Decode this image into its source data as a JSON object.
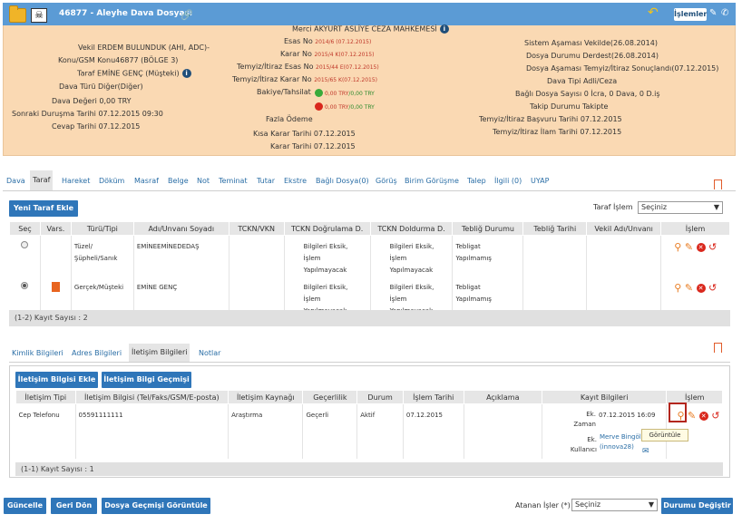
{
  "header": {
    "title": "46877 - Aleyhe Dava Dosyası",
    "actions_label": "İşlemler",
    "court": "Merci AKYURT ASLİYE CEZA MAHKEMESİ",
    "left": [
      "Vekil ERDEM BULUNDUK (AHI, ADC)-",
      "Konu/GSM Konu46877 (BÖLGE 3)",
      "Taraf EMİNE GENÇ (Müşteki)",
      "Dava Türü Diğer(Diğer)",
      "Dava Değeri 0,00 TRY",
      "Sonraki Duruşma Tarihi 07.12.2015 09:30",
      "Cevap Tarihi 07.12.2015"
    ],
    "middle": {
      "esas_label": "Esas No",
      "esas_value": "2014/6 (07.12.2015)",
      "karar_label": "Karar No",
      "karar_value": "2015/4 K(07.12.2015)",
      "temyiz_esas_label": "Temyiz/İtiraz Esas No",
      "temyiz_esas_value": "2015/44 E(07.12.2015)",
      "temyiz_karar_label": "Temyiz/İtiraz Karar No",
      "temyiz_karar_value": "2015/65 K(07.12.2015)",
      "bakiye_label": "Bakiye/Tahsilat",
      "bakiye_in_red": "0,00 TRY",
      "bakiye_in_green": "0,00 TRY",
      "bakiye_out_red": "0,00 TRY",
      "bakiye_out_green": "0,00 TRY",
      "fazla_odeme": "Fazla Ödeme",
      "kisa_karar": "Kısa Karar Tarihi 07.12.2015",
      "karar_tarihi": "Karar Tarihi 07.12.2015"
    },
    "right": [
      "Sistem Aşaması Vekilde(26.08.2014)",
      "Dosya Durumu Derdest(26.08.2014)",
      "Dosya Aşaması Temyiz/İtiraz Sonuçlandı(07.12.2015)",
      "Dava Tipi Adli/Ceza",
      "Bağlı Dosya Sayısı 0 İcra, 0 Dava, 0 D.iş",
      "Takip Durumu Takipte",
      "Temyiz/İtiraz Başvuru Tarihi 07.12.2015",
      "Temyiz/İtiraz İlam Tarihi 07.12.2015"
    ]
  },
  "tabs": [
    "Dava",
    "Taraf",
    "Hareket",
    "Döküm",
    "Masraf",
    "Belge",
    "Not",
    "Teminat",
    "Tutar",
    "Ekstre",
    "Bağlı Dosya(0)",
    "Görüş",
    "Birim Görüşme",
    "Talep",
    "İlgili (0)",
    "UYAP"
  ],
  "taraf": {
    "add_button": "Yeni Taraf Ekle",
    "islem_label": "Taraf İşlem",
    "islem_select": "Seçiniz",
    "columns": [
      "Seç",
      "Vars.",
      "Türü/Tipi",
      "Adı/Unvanı Soyadı",
      "TCKN/VKN",
      "TCKN Doğrulama D.",
      "TCKN Doldurma D.",
      "Tebliğ Durumu",
      "Tebliğ Tarihi",
      "Vekil Adı/Unvanı",
      "İşlem"
    ],
    "rows": [
      {
        "type_1": "Tüzel/",
        "type_2": "Şüpheli/Sanık",
        "name": "EMİNEEMİNEDEDAŞ",
        "dogrulama_1": "Bilgileri Eksik,",
        "dogrulama_2": "İşlem",
        "dogrulama_3": "Yapılmayacak",
        "doldurma_1": "Bilgileri Eksik,",
        "doldurma_2": "İşlem",
        "doldurma_3": "Yapılmayacak",
        "teblig_1": "Tebligat",
        "teblig_2": "Yapılmamış"
      },
      {
        "type_1": "Gerçek/Müşteki",
        "type_2": "",
        "name": "EMİNE GENÇ",
        "dogrulama_1": "Bilgileri Eksik,",
        "dogrulama_2": "İşlem",
        "dogrulama_3": "Yapılmayacak",
        "doldurma_1": "Bilgileri Eksik,",
        "doldurma_2": "İşlem",
        "doldurma_3": "Yapılmayacak",
        "teblig_1": "Tebligat",
        "teblig_2": "Yapılmamış"
      }
    ],
    "footer": "(1-2) Kayıt Sayısı : 2"
  },
  "subtabs": [
    "Kimlik Bilgileri",
    "Adres Bilgileri",
    "İletişim Bilgileri",
    "Notlar"
  ],
  "iletisim": {
    "add_button": "İletişim Bilgisi Ekle",
    "history_button": "İletişim Bilgi Geçmişi",
    "columns": [
      "İletişim Tipi",
      "İletişim Bilgisi (Tel/Faks/GSM/E-posta)",
      "İletişim Kaynağı",
      "Geçerlilik",
      "Durum",
      "İşlem Tarihi",
      "Açıklama",
      "Kayıt Bilgileri",
      "İşlem"
    ],
    "row": {
      "tip": "Cep Telefonu",
      "bilgi": "05591111111",
      "kaynak": "Araştırma",
      "gecerlilik": "Geçerli",
      "durum": "Aktif",
      "tarih": "07.12.2015",
      "ek_zaman_label_1": "Ek.",
      "ek_zaman_label_2": "Zaman",
      "ek_zaman_value": "07.12.2015 16:09",
      "ek_kullanici_label_1": "Ek.",
      "ek_kullanici_label_2": "Kullanıcı",
      "ek_kullanici_name": "Merve Bingöl",
      "ek_kullanici_code": "(innova28)"
    },
    "footer": "(1-1) Kayıt Sayısı : 1",
    "tooltip": "Görüntüle"
  },
  "bottom": {
    "guncelle": "Güncelle",
    "geri_don": "Geri Dön",
    "gecmis": "Dosya Geçmişi Görüntüle",
    "atanan_label": "Atanan İşler (*)",
    "atanan_select": "Seçiniz",
    "durum_button": "Durumu Değiştir"
  },
  "colors": {
    "header_bg": "#fad9b3",
    "titlebar": "#5b9bd5",
    "button": "#2f76b9",
    "link": "#2a6ea6",
    "action_orange": "#e87a1f",
    "action_red": "#d9271c"
  }
}
